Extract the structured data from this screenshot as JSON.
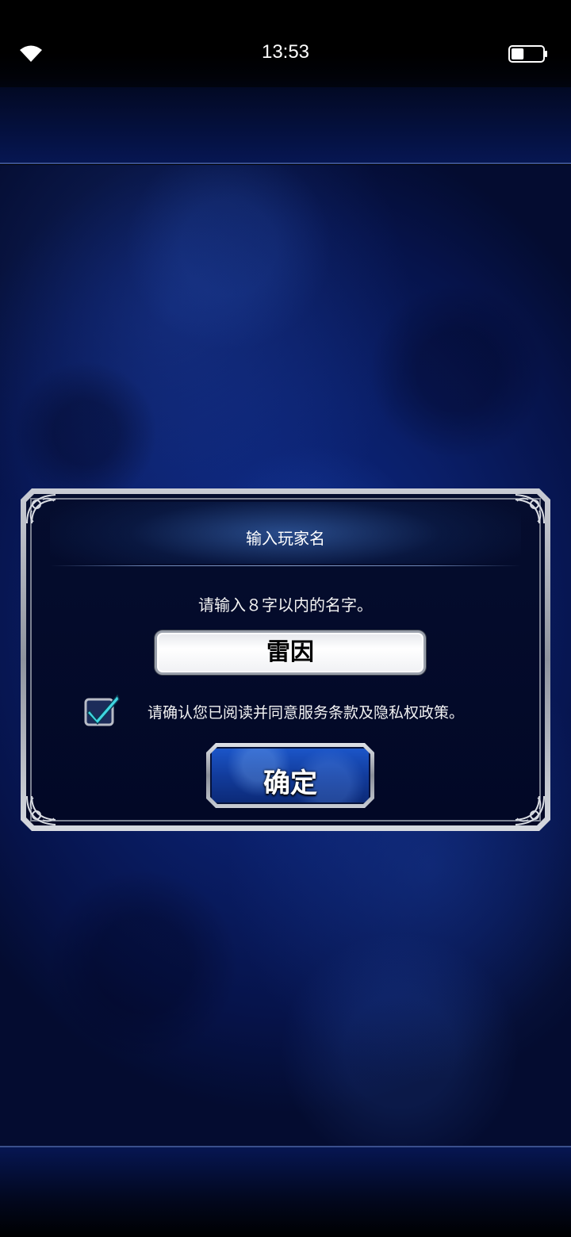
{
  "status_bar": {
    "time": "13:53",
    "icons": [
      "wifi-icon",
      "battery-icon"
    ],
    "battery_level": 0.4
  },
  "dialog": {
    "title": "输入玩家名",
    "instruction": "请输入８字以内的名字。",
    "name_input": {
      "value": "雷因"
    },
    "consent": {
      "checked": true,
      "text": "请确认您已阅读并同意服务条款及隐私权政策。"
    },
    "confirm_button": {
      "label": "确定"
    }
  },
  "colors": {
    "background": "#0a1f6a",
    "dialog_inner": "#050d2e",
    "dialog_frame": "#c9ccd4",
    "button": "#1b55c8",
    "checkmark": "#3fd6e0"
  }
}
